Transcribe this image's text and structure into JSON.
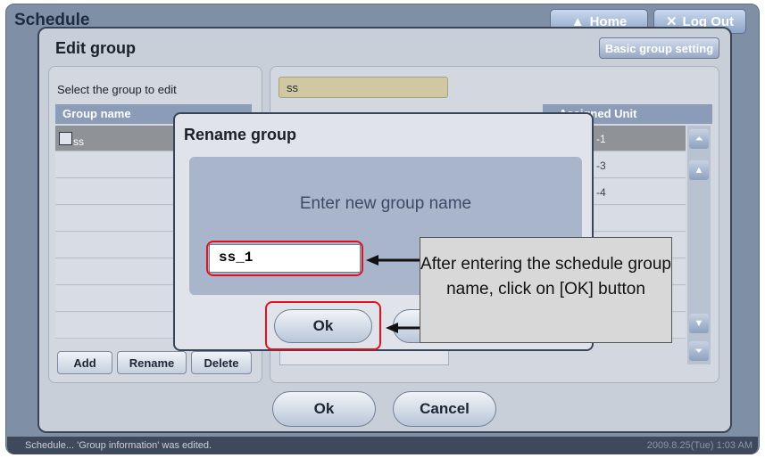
{
  "app": {
    "title": "Schedule",
    "home_label": "Home",
    "logout_label": "Log Out",
    "status_message": "Schedule... 'Group information' was edited.",
    "status_time": "2009.8.25(Tue)  1:03 AM"
  },
  "edit_group": {
    "title": "Edit group",
    "basic_setting_label": "Basic group setting",
    "select_label": "Select the group to edit",
    "list_header": "Group name",
    "groups": [
      "ss"
    ],
    "add_label": "Add",
    "rename_label": "Rename",
    "delete_label": "Delete",
    "group_name_value": "ss",
    "assigned_header": "Assigned Unit",
    "assigned_units": [
      "-1",
      "-3",
      "-4"
    ],
    "ok_label": "Ok",
    "cancel_label": "Cancel"
  },
  "rename_dialog": {
    "title": "Rename group",
    "prompt": "Enter new group name",
    "input_value": "ss_1",
    "ok_label": "Ok"
  },
  "callout": {
    "text": "After entering the schedule group name, click on [OK] button",
    "highlight_color": "#e3111b"
  }
}
